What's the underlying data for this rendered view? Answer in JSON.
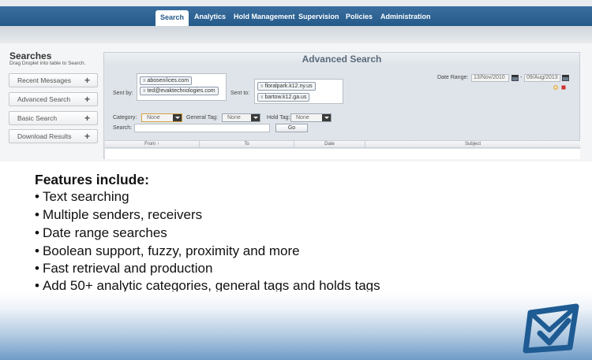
{
  "nav": {
    "items": [
      "Search",
      "Analytics",
      "Hold Management",
      "Supervision",
      "Policies",
      "Administration"
    ],
    "active": "Search"
  },
  "sidebar": {
    "title": "Searches",
    "subtitle": "Drag Droplet into table to Search.",
    "buttons": [
      "Recent Messages",
      "Advanced Search",
      "Basic Search",
      "Download Results"
    ],
    "plus": "+"
  },
  "advanced": {
    "title": "Advanced Search",
    "sent_by_label": "Sent by:",
    "sent_by": [
      "abosen/ices.com",
      "ted@evaktechnologies.com"
    ],
    "sent_to_label": "Sent to:",
    "sent_to": [
      "floralpark.k12.ny.us",
      "bartow.k12.ga.us"
    ],
    "chip_x": "x",
    "date_range_label": "Date Range:",
    "date_from": "13/Nov/2010",
    "date_sep": "-",
    "date_to": "09/Aug/2013",
    "category_label": "Category:",
    "category_value": "None",
    "general_tag_label": "General Tag:",
    "general_tag_value": "None",
    "hold_tag_label": "Hold Tag:",
    "hold_tag_value": "None",
    "search_label": "Search:",
    "search_value": "",
    "go_label": "Go",
    "columns": [
      "From ↑",
      "To",
      "Date",
      "Subject"
    ]
  },
  "features": {
    "title": "Features include:",
    "bullet": "•",
    "items": [
      "Text searching",
      "Multiple senders, receivers",
      "Date range searches",
      "Boolean support, fuzzy, proximity and more",
      "Fast retrieval and production",
      "Add 50+ analytic categories, general tags and holds tags"
    ]
  },
  "colors": {
    "nav": "#245a8a",
    "logo": "#1f5b93"
  }
}
